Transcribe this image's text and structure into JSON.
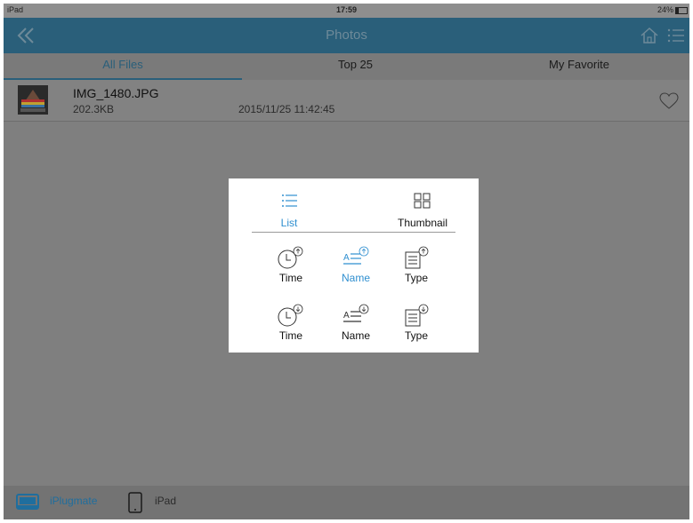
{
  "status_bar": {
    "device": "iPad",
    "time": "17:59",
    "battery": "24%"
  },
  "nav": {
    "title": "Photos"
  },
  "tabs": [
    {
      "label": "All Files",
      "active": true
    },
    {
      "label": "Top 25",
      "active": false
    },
    {
      "label": "My Favorite",
      "active": false
    }
  ],
  "file": {
    "name": "IMG_1480.JPG",
    "size": "202.3KB",
    "date": "2015/11/25 11:42:45"
  },
  "popup": {
    "view_modes": [
      {
        "label": "List",
        "icon": "list-icon",
        "selected": true
      },
      {
        "label": "Thumbnail",
        "icon": "grid-icon",
        "selected": false
      }
    ],
    "sort_ascending": [
      {
        "label": "Time",
        "icon": "clock-up-icon",
        "selected": false
      },
      {
        "label": "Name",
        "icon": "name-up-icon",
        "selected": true
      },
      {
        "label": "Type",
        "icon": "doc-up-icon",
        "selected": false
      }
    ],
    "sort_descending": [
      {
        "label": "Time",
        "icon": "clock-down-icon",
        "selected": false
      },
      {
        "label": "Name",
        "icon": "name-down-icon",
        "selected": false
      },
      {
        "label": "Type",
        "icon": "doc-down-icon",
        "selected": false
      }
    ]
  },
  "bottom_bar": [
    {
      "label": "iPlugmate",
      "active": true
    },
    {
      "label": "iPad",
      "active": false
    }
  ],
  "colors": {
    "accent": "#2f8fd0",
    "navbar": "#2a5f7a",
    "overlay_bg": "#7f7f7f"
  }
}
